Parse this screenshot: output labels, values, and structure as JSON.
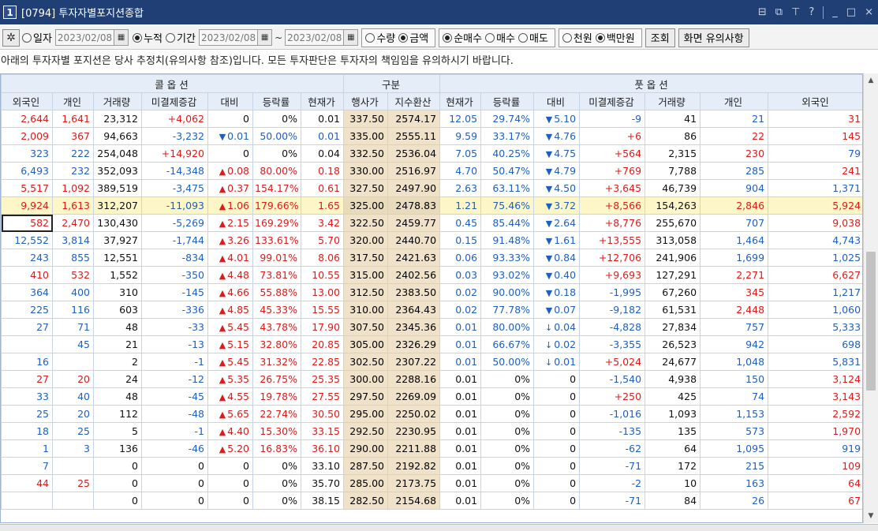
{
  "window": {
    "number": "1",
    "title": "[0794] 투자자별포지션종합",
    "icons": [
      "layout-icon",
      "copy-icon",
      "pin-icon",
      "help-icon",
      "minimize-icon",
      "maximize-icon",
      "close-icon"
    ],
    "icon_glyphs": [
      "⊟",
      "⧉",
      "⊤",
      "?",
      "_",
      "□",
      "×"
    ]
  },
  "toolbar": {
    "gear_glyph": "✲",
    "period": [
      {
        "label": "일자",
        "selected": false
      },
      {
        "label": "누적",
        "selected": true
      },
      {
        "label": "기간",
        "selected": false
      }
    ],
    "date_single": "2023/02/08",
    "date_from": "2023/02/08",
    "date_to": "2023/02/08",
    "tilde": "~",
    "cal_glyph": "▦",
    "unit_type": [
      {
        "label": "수량",
        "selected": false
      },
      {
        "label": "금액",
        "selected": true
      }
    ],
    "trade_type": [
      {
        "label": "순매수",
        "selected": true
      },
      {
        "label": "매수",
        "selected": false
      },
      {
        "label": "매도",
        "selected": false
      }
    ],
    "money_unit": [
      {
        "label": "천원",
        "selected": false
      },
      {
        "label": "백만원",
        "selected": true
      }
    ],
    "query_button": "조회",
    "notice_button": "화면 유의사항"
  },
  "notice": "아래의 투자자별 포지션은 당사 추정치(유의사항 참조)입니다. 모든 투자판단은 투자자의 책임임을 유의하시기 바랍니다.",
  "grid": {
    "group_headers": {
      "call": "콜 옵 션",
      "mid": "구분",
      "put": "풋 옵 션"
    },
    "columns": [
      "외국인",
      "개인",
      "거래량",
      "미결제증감",
      "대비",
      "등락률",
      "현재가",
      "행사가",
      "지수환산",
      "현재가",
      "등락률",
      "대비",
      "미결제증감",
      "거래량",
      "개인",
      "외국인"
    ],
    "rows": [
      {
        "c_for": "2,644",
        "c_ind": "1,641",
        "c_vol": "23,312",
        "c_oi": "+4,062",
        "c_chg_dir": "",
        "c_chg": "0",
        "c_rate": "0%",
        "c_px": "0.01",
        "strike": "337.50",
        "idx": "2574.17",
        "p_px": "12.05",
        "p_rate": "29.74%",
        "p_chg_dir": "down",
        "p_chg": "5.10",
        "p_oi": "-9",
        "p_vol": "41",
        "p_ind": "21",
        "p_for": "31"
      },
      {
        "c_for": "2,009",
        "c_ind": "367",
        "c_vol": "94,663",
        "c_oi": "-3,232",
        "c_chg_dir": "down",
        "c_chg": "0.01",
        "c_rate": "50.00%",
        "c_px": "0.01",
        "strike": "335.00",
        "idx": "2555.11",
        "p_px": "9.59",
        "p_rate": "33.17%",
        "p_chg_dir": "down",
        "p_chg": "4.76",
        "p_oi": "+6",
        "p_vol": "86",
        "p_ind": "22",
        "p_for": "145"
      },
      {
        "c_for": "323",
        "c_ind": "222",
        "c_vol": "254,048",
        "c_oi": "+14,920",
        "c_chg_dir": "",
        "c_chg": "0",
        "c_rate": "0%",
        "c_px": "0.04",
        "strike": "332.50",
        "idx": "2536.04",
        "p_px": "7.05",
        "p_rate": "40.25%",
        "p_chg_dir": "down",
        "p_chg": "4.75",
        "p_oi": "+564",
        "p_vol": "2,315",
        "p_ind": "230",
        "p_for": "79"
      },
      {
        "c_for": "6,493",
        "c_ind": "232",
        "c_vol": "352,093",
        "c_oi": "-14,348",
        "c_chg_dir": "up",
        "c_chg": "0.08",
        "c_rate": "80.00%",
        "c_px": "0.18",
        "strike": "330.00",
        "idx": "2516.97",
        "p_px": "4.70",
        "p_rate": "50.47%",
        "p_chg_dir": "down",
        "p_chg": "4.79",
        "p_oi": "+769",
        "p_vol": "7,788",
        "p_ind": "285",
        "p_for": "241"
      },
      {
        "c_for": "5,517",
        "c_ind": "1,092",
        "c_vol": "389,519",
        "c_oi": "-3,475",
        "c_chg_dir": "up",
        "c_chg": "0.37",
        "c_rate": "154.17%",
        "c_px": "0.61",
        "strike": "327.50",
        "idx": "2497.90",
        "p_px": "2.63",
        "p_rate": "63.11%",
        "p_chg_dir": "down",
        "p_chg": "4.50",
        "p_oi": "+3,645",
        "p_vol": "46,739",
        "p_ind": "904",
        "p_for": "1,371"
      },
      {
        "c_for": "9,924",
        "c_ind": "1,613",
        "c_vol": "312,207",
        "c_oi": "-11,093",
        "c_chg_dir": "up",
        "c_chg": "1.06",
        "c_rate": "179.66%",
        "c_px": "1.65",
        "strike": "325.00",
        "idx": "2478.83",
        "p_px": "1.21",
        "p_rate": "75.46%",
        "p_chg_dir": "down",
        "p_chg": "3.72",
        "p_oi": "+8,566",
        "p_vol": "154,263",
        "p_ind": "2,846",
        "p_for": "5,924"
      },
      {
        "c_for": "582",
        "c_ind": "2,470",
        "c_vol": "130,430",
        "c_oi": "-5,269",
        "c_chg_dir": "up",
        "c_chg": "2.15",
        "c_rate": "169.29%",
        "c_px": "3.42",
        "strike": "322.50",
        "idx": "2459.77",
        "p_px": "0.45",
        "p_rate": "85.44%",
        "p_chg_dir": "down",
        "p_chg": "2.64",
        "p_oi": "+8,776",
        "p_vol": "255,670",
        "p_ind": "707",
        "p_for": "9,038"
      },
      {
        "c_for": "12,552",
        "c_ind": "3,814",
        "c_vol": "37,927",
        "c_oi": "-1,744",
        "c_chg_dir": "up",
        "c_chg": "3.26",
        "c_rate": "133.61%",
        "c_px": "5.70",
        "strike": "320.00",
        "idx": "2440.70",
        "p_px": "0.15",
        "p_rate": "91.48%",
        "p_chg_dir": "down",
        "p_chg": "1.61",
        "p_oi": "+13,555",
        "p_vol": "313,058",
        "p_ind": "1,464",
        "p_for": "4,743"
      },
      {
        "c_for": "243",
        "c_ind": "855",
        "c_vol": "12,551",
        "c_oi": "-834",
        "c_chg_dir": "up",
        "c_chg": "4.01",
        "c_rate": "99.01%",
        "c_px": "8.06",
        "strike": "317.50",
        "idx": "2421.63",
        "p_px": "0.06",
        "p_rate": "93.33%",
        "p_chg_dir": "down",
        "p_chg": "0.84",
        "p_oi": "+12,706",
        "p_vol": "241,906",
        "p_ind": "1,699",
        "p_for": "1,025"
      },
      {
        "c_for": "410",
        "c_ind": "532",
        "c_vol": "1,552",
        "c_oi": "-350",
        "c_chg_dir": "up",
        "c_chg": "4.48",
        "c_rate": "73.81%",
        "c_px": "10.55",
        "strike": "315.00",
        "idx": "2402.56",
        "p_px": "0.03",
        "p_rate": "93.02%",
        "p_chg_dir": "down",
        "p_chg": "0.40",
        "p_oi": "+9,693",
        "p_vol": "127,291",
        "p_ind": "2,271",
        "p_for": "6,627"
      },
      {
        "c_for": "364",
        "c_ind": "400",
        "c_vol": "310",
        "c_oi": "-145",
        "c_chg_dir": "up",
        "c_chg": "4.66",
        "c_rate": "55.88%",
        "c_px": "13.00",
        "strike": "312.50",
        "idx": "2383.50",
        "p_px": "0.02",
        "p_rate": "90.00%",
        "p_chg_dir": "down",
        "p_chg": "0.18",
        "p_oi": "-1,995",
        "p_vol": "67,260",
        "p_ind": "345",
        "p_for": "1,217"
      },
      {
        "c_for": "225",
        "c_ind": "116",
        "c_vol": "603",
        "c_oi": "-336",
        "c_chg_dir": "up",
        "c_chg": "4.85",
        "c_rate": "45.33%",
        "c_px": "15.55",
        "strike": "310.00",
        "idx": "2364.43",
        "p_px": "0.02",
        "p_rate": "77.78%",
        "p_chg_dir": "down",
        "p_chg": "0.07",
        "p_oi": "-9,182",
        "p_vol": "61,531",
        "p_ind": "2,448",
        "p_for": "1,060"
      },
      {
        "c_for": "27",
        "c_ind": "71",
        "c_vol": "48",
        "c_oi": "-33",
        "c_chg_dir": "up",
        "c_chg": "5.45",
        "c_rate": "43.78%",
        "c_px": "17.90",
        "strike": "307.50",
        "idx": "2345.36",
        "p_px": "0.01",
        "p_rate": "80.00%",
        "p_chg_dir": "downarrow",
        "p_chg": "0.04",
        "p_oi": "-4,828",
        "p_vol": "27,834",
        "p_ind": "757",
        "p_for": "5,333"
      },
      {
        "c_for": "",
        "c_ind": "45",
        "c_vol": "21",
        "c_oi": "-13",
        "c_chg_dir": "up",
        "c_chg": "5.15",
        "c_rate": "32.80%",
        "c_px": "20.85",
        "strike": "305.00",
        "idx": "2326.29",
        "p_px": "0.01",
        "p_rate": "66.67%",
        "p_chg_dir": "downarrow",
        "p_chg": "0.02",
        "p_oi": "-3,355",
        "p_vol": "26,523",
        "p_ind": "942",
        "p_for": "698"
      },
      {
        "c_for": "16",
        "c_ind": "",
        "c_vol": "2",
        "c_oi": "-1",
        "c_chg_dir": "up",
        "c_chg": "5.45",
        "c_rate": "31.32%",
        "c_px": "22.85",
        "strike": "302.50",
        "idx": "2307.22",
        "p_px": "0.01",
        "p_rate": "50.00%",
        "p_chg_dir": "downarrow",
        "p_chg": "0.01",
        "p_oi": "+5,024",
        "p_vol": "24,677",
        "p_ind": "1,048",
        "p_for": "5,831"
      },
      {
        "c_for": "27",
        "c_ind": "20",
        "c_vol": "24",
        "c_oi": "-12",
        "c_chg_dir": "up",
        "c_chg": "5.35",
        "c_rate": "26.75%",
        "c_px": "25.35",
        "strike": "300.00",
        "idx": "2288.16",
        "p_px": "0.01",
        "p_rate": "0%",
        "p_chg_dir": "",
        "p_chg": "0",
        "p_oi": "-1,540",
        "p_vol": "4,938",
        "p_ind": "150",
        "p_for": "3,124"
      },
      {
        "c_for": "33",
        "c_ind": "40",
        "c_vol": "48",
        "c_oi": "-45",
        "c_chg_dir": "up",
        "c_chg": "4.55",
        "c_rate": "19.78%",
        "c_px": "27.55",
        "strike": "297.50",
        "idx": "2269.09",
        "p_px": "0.01",
        "p_rate": "0%",
        "p_chg_dir": "",
        "p_chg": "0",
        "p_oi": "+250",
        "p_vol": "425",
        "p_ind": "74",
        "p_for": "3,143"
      },
      {
        "c_for": "25",
        "c_ind": "20",
        "c_vol": "112",
        "c_oi": "-48",
        "c_chg_dir": "up",
        "c_chg": "5.65",
        "c_rate": "22.74%",
        "c_px": "30.50",
        "strike": "295.00",
        "idx": "2250.02",
        "p_px": "0.01",
        "p_rate": "0%",
        "p_chg_dir": "",
        "p_chg": "0",
        "p_oi": "-1,016",
        "p_vol": "1,093",
        "p_ind": "1,153",
        "p_for": "2,592"
      },
      {
        "c_for": "18",
        "c_ind": "25",
        "c_vol": "5",
        "c_oi": "-1",
        "c_chg_dir": "up",
        "c_chg": "4.40",
        "c_rate": "15.30%",
        "c_px": "33.15",
        "strike": "292.50",
        "idx": "2230.95",
        "p_px": "0.01",
        "p_rate": "0%",
        "p_chg_dir": "",
        "p_chg": "0",
        "p_oi": "-135",
        "p_vol": "135",
        "p_ind": "573",
        "p_for": "1,970"
      },
      {
        "c_for": "1",
        "c_ind": "3",
        "c_vol": "136",
        "c_oi": "-46",
        "c_chg_dir": "up",
        "c_chg": "5.20",
        "c_rate": "16.83%",
        "c_px": "36.10",
        "strike": "290.00",
        "idx": "2211.88",
        "p_px": "0.01",
        "p_rate": "0%",
        "p_chg_dir": "",
        "p_chg": "0",
        "p_oi": "-62",
        "p_vol": "64",
        "p_ind": "1,095",
        "p_for": "919"
      },
      {
        "c_for": "7",
        "c_ind": "",
        "c_vol": "0",
        "c_oi": "0",
        "c_chg_dir": "",
        "c_chg": "0",
        "c_rate": "0%",
        "c_px": "33.10",
        "strike": "287.50",
        "idx": "2192.82",
        "p_px": "0.01",
        "p_rate": "0%",
        "p_chg_dir": "",
        "p_chg": "0",
        "p_oi": "-71",
        "p_vol": "172",
        "p_ind": "215",
        "p_for": "109"
      },
      {
        "c_for": "44",
        "c_ind": "25",
        "c_vol": "0",
        "c_oi": "0",
        "c_chg_dir": "",
        "c_chg": "0",
        "c_rate": "0%",
        "c_px": "35.70",
        "strike": "285.00",
        "idx": "2173.75",
        "p_px": "0.01",
        "p_rate": "0%",
        "p_chg_dir": "",
        "p_chg": "0",
        "p_oi": "-2",
        "p_vol": "10",
        "p_ind": "163",
        "p_for": "64"
      },
      {
        "c_for": "",
        "c_ind": "",
        "c_vol": "0",
        "c_oi": "0",
        "c_chg_dir": "",
        "c_chg": "0",
        "c_rate": "0%",
        "c_px": "38.15",
        "strike": "282.50",
        "idx": "2154.68",
        "p_px": "0.01",
        "p_rate": "0%",
        "p_chg_dir": "",
        "p_chg": "0",
        "p_oi": "-71",
        "p_vol": "84",
        "p_ind": "26",
        "p_for": "67"
      }
    ],
    "highlight_row": 5,
    "selected_row": 6
  },
  "colors": {
    "red": "#e01a1a",
    "blue": "#1f5fbf",
    "title_bg": "#1f3f75",
    "header_bg": "#e4edf8",
    "strike_bg": "#efe2c8",
    "highlight_bg": "#fdf7c7"
  }
}
